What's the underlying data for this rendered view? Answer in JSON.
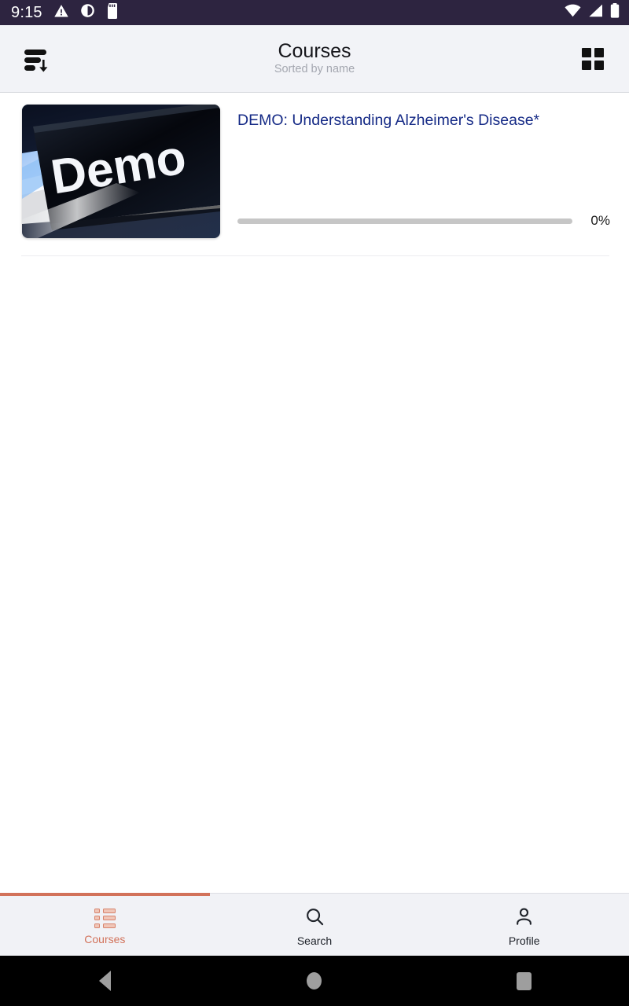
{
  "status_bar": {
    "clock": "9:15",
    "left_icons": [
      "warning-triangle-icon",
      "contrast-circle-icon",
      "sd-card-icon"
    ],
    "right_icons": [
      "wifi-icon",
      "cellular-signal-icon",
      "battery-icon"
    ],
    "background_color": "#2d2440"
  },
  "app_bar": {
    "title": "Courses",
    "subtitle": "Sorted by name",
    "sort_icon": "sort-descending-icon",
    "view_toggle_icon": "grid-view-icon",
    "background_color": "#f2f3f7"
  },
  "courses": [
    {
      "title": "DEMO: Understanding Alzheimer's Disease*",
      "thumbnail_alt": "Demo keyboard key",
      "thumbnail_text": "Demo",
      "progress_percent": 0,
      "progress_label": "0%",
      "title_color": "#152a86"
    }
  ],
  "bottom_nav": {
    "active_index": 0,
    "accent_color": "#d2725a",
    "items": [
      {
        "label": "Courses",
        "icon": "courses-grid-icon"
      },
      {
        "label": "Search",
        "icon": "search-icon"
      },
      {
        "label": "Profile",
        "icon": "person-icon"
      }
    ]
  },
  "android_nav": {
    "buttons": [
      {
        "name": "back",
        "icon": "back-triangle-icon"
      },
      {
        "name": "home",
        "icon": "home-circle-icon"
      },
      {
        "name": "recents",
        "icon": "recents-square-icon"
      }
    ]
  }
}
